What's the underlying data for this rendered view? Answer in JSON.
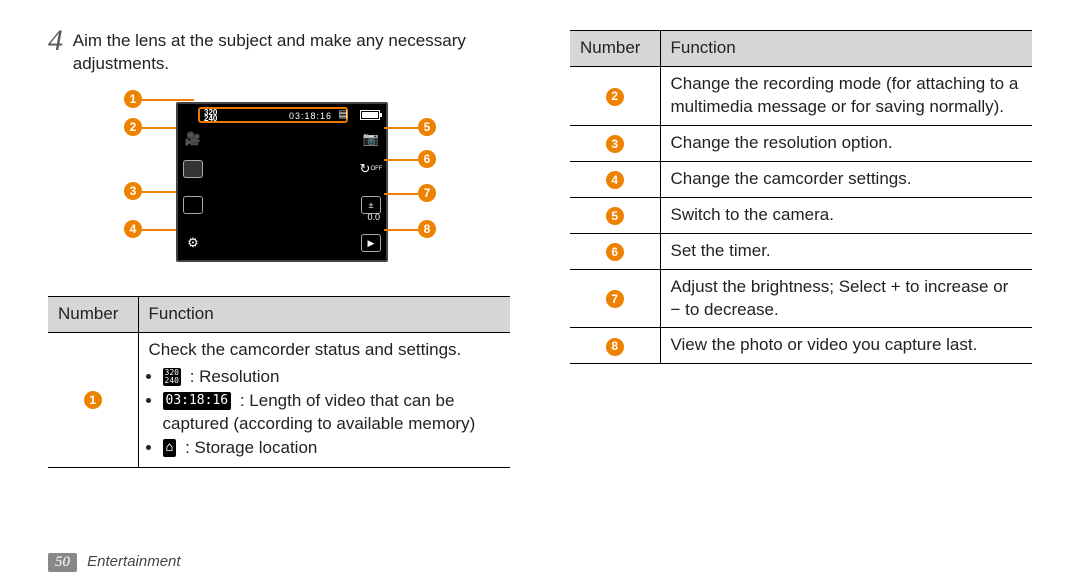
{
  "step": {
    "number": "4",
    "text": "Aim the lens at the subject and make any necessary adjustments."
  },
  "diagram": {
    "resolution_label": "320\n240",
    "time_label": "03:18:16",
    "ev_label": "0.0",
    "callouts": [
      "1",
      "2",
      "3",
      "4",
      "5",
      "6",
      "7",
      "8"
    ]
  },
  "left_table": {
    "headers": {
      "num": "Number",
      "func": "Function"
    },
    "row1": {
      "num": "1",
      "lead": "Check the camcorder status and settings.",
      "items": {
        "a_icon": "320/240",
        "a_text": ": Resolution",
        "b_icon": "03:18:16",
        "b_text": ": Length of video that can be captured (according to available memory)",
        "c_icon": "⌂",
        "c_text": ": Storage location"
      }
    }
  },
  "right_table": {
    "headers": {
      "num": "Number",
      "func": "Function"
    },
    "rows": [
      {
        "num": "2",
        "text": "Change the recording mode (for attaching to a multimedia message or for saving normally)."
      },
      {
        "num": "3",
        "text": "Change the resolution option."
      },
      {
        "num": "4",
        "text": "Change the camcorder settings."
      },
      {
        "num": "5",
        "text": "Switch to the camera."
      },
      {
        "num": "6",
        "text": "Set the timer."
      },
      {
        "num": "7",
        "text": "Adjust the brightness; Select + to increase or − to decrease."
      },
      {
        "num": "8",
        "text": "View the photo or video you capture last."
      }
    ]
  },
  "footer": {
    "page": "50",
    "section": "Entertainment"
  }
}
